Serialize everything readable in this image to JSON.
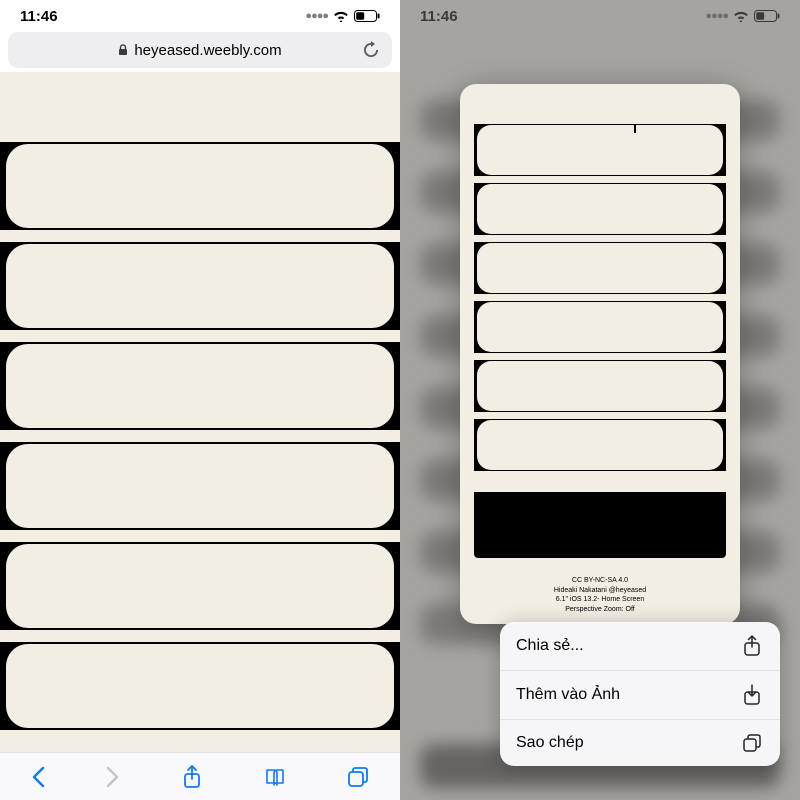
{
  "status": {
    "time": "11:46"
  },
  "safari": {
    "url_host": "heyeased.weebly.com"
  },
  "preview": {
    "caption_line1": "CC BY-NC-SA 4.0",
    "caption_line2": "Hideaki Nakatani @heyeased",
    "caption_line3": "6.1\"  iOS 13.2-  Home Screen",
    "caption_line4": "Perspective Zoom: Off"
  },
  "sheet": {
    "items": [
      {
        "label": "Chia sẻ...",
        "icon": "share-icon"
      },
      {
        "label": "Thêm vào Ảnh",
        "icon": "save-image-icon"
      },
      {
        "label": "Sao chép",
        "icon": "copy-icon"
      }
    ]
  }
}
